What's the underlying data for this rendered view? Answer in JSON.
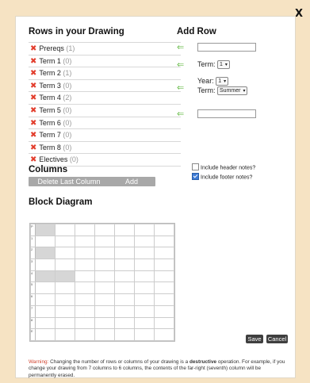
{
  "dialog": {
    "close_label": "X",
    "rows_heading": "Rows in your Drawing",
    "add_row_heading": "Add Row",
    "columns_heading": "Columns",
    "block_heading": "Block Diagram"
  },
  "rows": [
    {
      "name": "Prereqs",
      "count": "(1)"
    },
    {
      "name": "Term 1",
      "count": "(0)"
    },
    {
      "name": "Term 2",
      "count": "(1)"
    },
    {
      "name": "Term 3",
      "count": "(0)"
    },
    {
      "name": "Term 4",
      "count": "(2)"
    },
    {
      "name": "Term 5",
      "count": "(0)"
    },
    {
      "name": "Term 6",
      "count": "(0)"
    },
    {
      "name": "Term 7",
      "count": "(0)"
    },
    {
      "name": "Term 8",
      "count": "(0)"
    },
    {
      "name": "Electives",
      "count": "(0)"
    }
  ],
  "add_row": {
    "term_label": "Term:",
    "term_value": "1",
    "year_label": "Year:",
    "year_value": "1",
    "term2_label": "Term:",
    "term2_value": "Summer"
  },
  "columns": {
    "delete_label": "Delete Last Column",
    "add_label": "Add Column"
  },
  "notes": {
    "header_label": "Include header notes?",
    "header_checked": false,
    "footer_label": "Include footer notes?",
    "footer_checked": true
  },
  "grid": {
    "row_labels": [
      "P",
      "1",
      "2",
      "3",
      "4",
      "5",
      "6",
      "7",
      "8",
      "E"
    ],
    "column_count": 7,
    "shaded": [
      [
        0,
        0
      ],
      [
        2,
        0
      ],
      [
        4,
        0
      ],
      [
        4,
        1
      ]
    ]
  },
  "actions": {
    "save_label": "Save",
    "cancel_label": "Cancel"
  },
  "warning": {
    "lead": "Warning:",
    "part1": " Changing the number of rows or columns of your drawing is a ",
    "bold": "destructive",
    "part2": " operation. For example, if you change your drawing from 7 columns to 6 columns, the contents of the far-right (seventh) column will be permanently erased."
  }
}
